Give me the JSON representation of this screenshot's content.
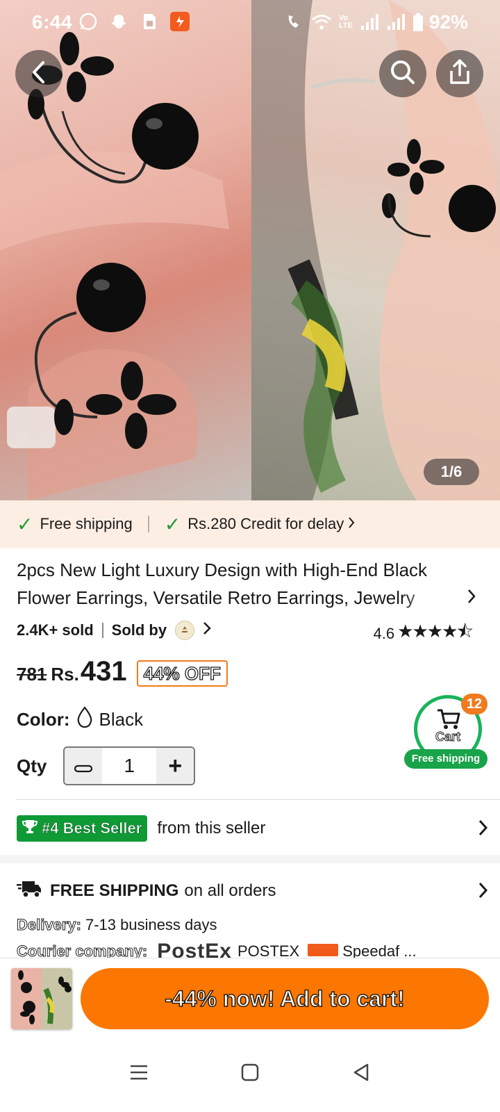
{
  "status_bar": {
    "time": "6:44",
    "battery": "92%",
    "left_icons": [
      "whatsapp-icon",
      "snapchat-icon",
      "sim-icon",
      "app-notification-icon"
    ],
    "right_icons": [
      "wifi-calling-icon",
      "wifi-icon",
      "volte-icon",
      "signal-icon",
      "signal-icon",
      "battery-icon"
    ]
  },
  "gallery": {
    "counter": "1/6",
    "back_icon": "back-arrow-icon",
    "search_icon": "search-icon",
    "share_icon": "share-icon"
  },
  "shipping_strip": {
    "item1": "Free shipping",
    "item2": "Rs.280 Credit for delay",
    "check_color": "#1f9d3a"
  },
  "product": {
    "title": "2pcs New Light Luxury Design with High-End Black Flower Earrings, Versatile Retro Earrings, Jewelry",
    "sold": "2.4K+ sold",
    "sold_by": "Sold by",
    "rating": "4.6",
    "stars": "★★★★⯪",
    "old_price": "781",
    "currency": "Rs.",
    "price": "431",
    "discount": "44% OFF",
    "color_label": "Color:",
    "color_value": "Black",
    "qty_label": "Qty",
    "qty_value": "1",
    "qty_minus": "−",
    "qty_plus": "+"
  },
  "cart_bubble": {
    "count": "12",
    "label": "Cart",
    "free_shipping": "Free shipping"
  },
  "best_seller": {
    "badge": "#4 Best Seller",
    "text": "from this seller"
  },
  "shipping_info": {
    "headline_strong": "FREE SHIPPING",
    "headline_rest": "on all orders",
    "delivery_label": "Delivery:",
    "delivery_value": "7-13 business days",
    "courier_label": "Courier company:",
    "courier_logo": "PostEx",
    "courier_name_1": "POSTEX",
    "courier_name_2": "Speedaf ..."
  },
  "action_bar": {
    "button": "-44% now! Add to cart!",
    "button_color": "#fb7701"
  },
  "nav": {
    "menu_icon": "recent-apps-icon",
    "home_icon": "home-icon",
    "back_icon": "back-triangle-icon"
  }
}
